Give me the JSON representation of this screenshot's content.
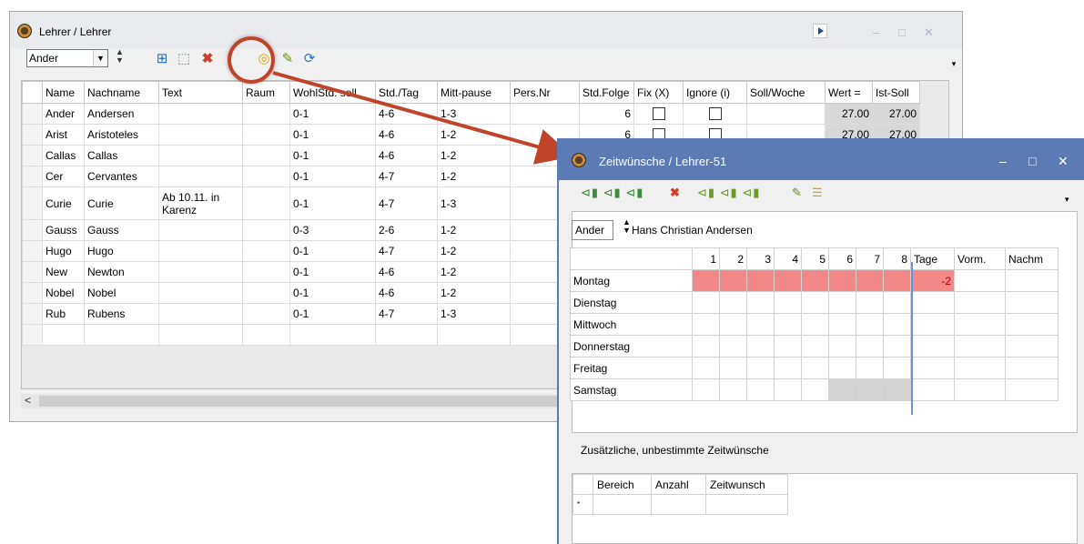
{
  "win1": {
    "title": "Lehrer / Lehrer",
    "toolbar": {
      "combo_value": "Ander",
      "combo_arrow": "▼",
      "spin": "▴\n▾"
    },
    "columns": [
      "Name",
      "Nachname",
      "Text",
      "Raum",
      "WohlStd. soll",
      "Std./Tag",
      "Mitt-pause",
      "Pers.Nr",
      "Std.Folge",
      "Fix (X)",
      "Ignore (i)",
      "Soll/Woche",
      "Wert =",
      "Ist-Soll"
    ],
    "rows": [
      {
        "name": "Ander",
        "nachname": "Andersen",
        "text": "",
        "wohl": "0-1",
        "stdtag": "4-6",
        "mitt": "1-3",
        "folge": "6",
        "wert": "27.00",
        "ist": "27.00"
      },
      {
        "name": "Arist",
        "nachname": "Aristoteles",
        "text": "",
        "wohl": "0-1",
        "stdtag": "4-6",
        "mitt": "1-2",
        "folge": "6",
        "wert": "27.00",
        "ist": "27.00"
      },
      {
        "name": "Callas",
        "nachname": "Callas",
        "text": "",
        "wohl": "0-1",
        "stdtag": "4-6",
        "mitt": "1-2",
        "folge": "",
        "wert": "",
        "ist": ""
      },
      {
        "name": "Cer",
        "nachname": "Cervantes",
        "text": "",
        "wohl": "0-1",
        "stdtag": "4-7",
        "mitt": "1-2",
        "folge": "",
        "wert": "",
        "ist": ""
      },
      {
        "name": "Curie",
        "nachname": "Curie",
        "text": "Ab 10.11. in Karenz",
        "wohl": "0-1",
        "stdtag": "4-7",
        "mitt": "1-3",
        "folge": "",
        "wert": "",
        "ist": ""
      },
      {
        "name": "Gauss",
        "nachname": "Gauss",
        "text": "",
        "wohl": "0-3",
        "stdtag": "2-6",
        "mitt": "1-2",
        "folge": "",
        "wert": "",
        "ist": ""
      },
      {
        "name": "Hugo",
        "nachname": "Hugo",
        "text": "",
        "wohl": "0-1",
        "stdtag": "4-7",
        "mitt": "1-2",
        "folge": "",
        "wert": "",
        "ist": ""
      },
      {
        "name": "New",
        "nachname": "Newton",
        "text": "",
        "wohl": "0-1",
        "stdtag": "4-6",
        "mitt": "1-2",
        "folge": "",
        "wert": "",
        "ist": ""
      },
      {
        "name": "Nobel",
        "nachname": "Nobel",
        "text": "",
        "wohl": "0-1",
        "stdtag": "4-6",
        "mitt": "1-2",
        "folge": "",
        "wert": "",
        "ist": ""
      },
      {
        "name": "Rub",
        "nachname": "Rubens",
        "text": "",
        "wohl": "0-1",
        "stdtag": "4-7",
        "mitt": "1-3",
        "folge": "",
        "wert": "",
        "ist": ""
      }
    ]
  },
  "win2": {
    "title": "Zeitwünsche / Lehrer-51",
    "selected_value": "Ander",
    "selected_name": "Hans Christian Andersen",
    "hours": [
      "1",
      "2",
      "3",
      "4",
      "5",
      "6",
      "7",
      "8"
    ],
    "tage_label": "Tage",
    "vorm_label": "Vorm.",
    "nachm_label": "Nachm",
    "days": [
      "Montag",
      "Dienstag",
      "Mittwoch",
      "Donnerstag",
      "Freitag",
      "Samstag"
    ],
    "montag_tage": "-2",
    "extra_label": "Zusätzliche, unbestimmte Zeitwünsche",
    "extra_columns": [
      "Bereich",
      "Anzahl",
      "Zeitwunsch"
    ],
    "extra_star": "*"
  },
  "icons": [
    "clock-icon",
    "add-icon",
    "new-icon",
    "delete-icon",
    "edit-icon",
    "refresh-icon"
  ]
}
